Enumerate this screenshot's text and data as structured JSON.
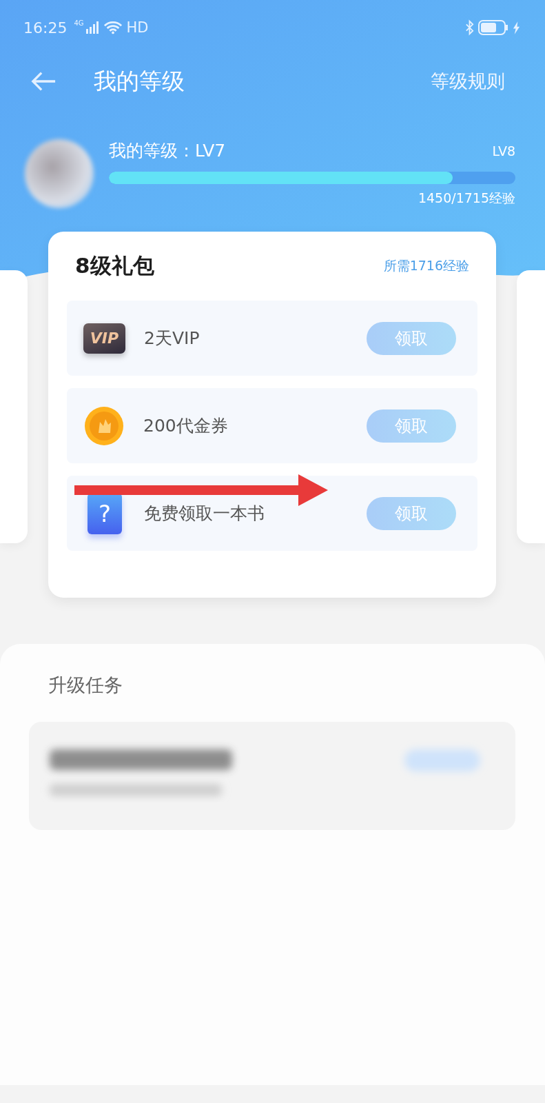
{
  "status_bar": {
    "time": "16:25",
    "network": "4G",
    "hd": "HD"
  },
  "header": {
    "title": "我的等级",
    "rules_link": "等级规则"
  },
  "profile": {
    "level_label": "我的等级：LV7",
    "next_level": "LV8",
    "level": 0.845,
    "exp": "1450/1715经验"
  },
  "gift_card": {
    "title": "8级礼包",
    "requirement": "所需1716经验",
    "rewards": [
      {
        "kind": "vip",
        "icon_text": "VIP",
        "label": "2天VIP",
        "button": "领取",
        "disabled": true
      },
      {
        "kind": "coin",
        "label": "200代金券",
        "button": "领取",
        "disabled": true
      },
      {
        "kind": "book",
        "icon_text": "?",
        "label": "免费领取一本书",
        "button": "领取",
        "disabled": true
      }
    ]
  },
  "tasks": {
    "title": "升级任务"
  }
}
